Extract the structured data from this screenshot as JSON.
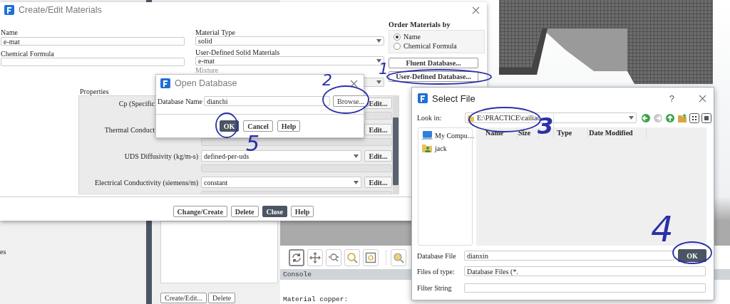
{
  "main_window": {
    "side_label": "es",
    "graphics_toolbar": [
      {
        "kind": "rotate",
        "selected": true
      },
      {
        "kind": "pan",
        "selected": false
      },
      {
        "kind": "zoom-in-out",
        "selected": false
      },
      {
        "kind": "zoom",
        "selected": false
      },
      {
        "kind": "zoom-box",
        "selected": false
      },
      {
        "kind": "zoom-fit",
        "selected": false
      }
    ],
    "list_buttons": [
      "Create/Edit...",
      "Delete"
    ],
    "console": {
      "title": "Console",
      "lines": [
        "Material copper:"
      ]
    }
  },
  "materials_dialog": {
    "title": "Create/Edit Materials",
    "name": {
      "label": "Name",
      "value": "e-mat"
    },
    "chemical_formula": {
      "label": "Chemical Formula"
    },
    "material_type": {
      "label": "Material Type",
      "value": "solid"
    },
    "user_materials": {
      "label": "User-Defined Solid Materials",
      "value": "e-mat"
    },
    "mixture": {
      "label": "Mixture",
      "disabled": true
    },
    "order_by": {
      "label": "Order Materials by",
      "options": [
        {
          "label": "Name",
          "selected": true
        },
        {
          "label": "Chemical Formula",
          "selected": false
        }
      ]
    },
    "database_buttons": [
      "Fluent Database...",
      "User-Defined Database..."
    ],
    "properties": {
      "label": "Properties",
      "rows": [
        {
          "kind": "covered",
          "label": "Cp (Specific",
          "edit": "Edit..."
        },
        {
          "kind": "partly-covered",
          "label": "Thermal Conduct",
          "edit": "Edit..."
        },
        {
          "kind": "dropdown",
          "label": "UDS Diffusivity (kg/m-s)",
          "value": "defined-per-uds",
          "edit": "Edit..."
        },
        {
          "kind": "dropdown",
          "label": "Electrical Conductivity (siemens/m)",
          "value": "constant",
          "edit": "Edit..."
        }
      ]
    },
    "buttons": [
      {
        "label": "Change/Create",
        "default": false
      },
      {
        "label": "Delete",
        "default": false
      },
      {
        "label": "Close",
        "default": true
      },
      {
        "label": "Help",
        "default": false
      }
    ]
  },
  "open_database_dialog": {
    "title": "Open Database",
    "field": {
      "label": "Database Name",
      "value": "dianchi"
    },
    "browse_button": "Browse...",
    "buttons": [
      {
        "label": "OK",
        "default": true
      },
      {
        "label": "Cancel",
        "default": false
      },
      {
        "label": "Help",
        "default": false
      }
    ]
  },
  "select_file_dialog": {
    "title": "Select File",
    "help": "?",
    "look_in": {
      "label": "Look in:",
      "value": "E:\\PRACTICE\\cailiao"
    },
    "places": [
      {
        "kind": "computer",
        "label": "My Compu…"
      },
      {
        "kind": "user",
        "label": "jack"
      }
    ],
    "columns": [
      "Name",
      "Size",
      "Type",
      "Date Modified"
    ],
    "database_file": {
      "label": "Database File",
      "value": "dianxin"
    },
    "ok_button": "OK",
    "files_of_type": {
      "label": "Files of type:",
      "value": "Database Files (*."
    },
    "filter_string": {
      "label": "Filter String"
    }
  },
  "annotations": {
    "numbers": [
      "1",
      "2",
      "3",
      "4",
      "5"
    ]
  }
}
